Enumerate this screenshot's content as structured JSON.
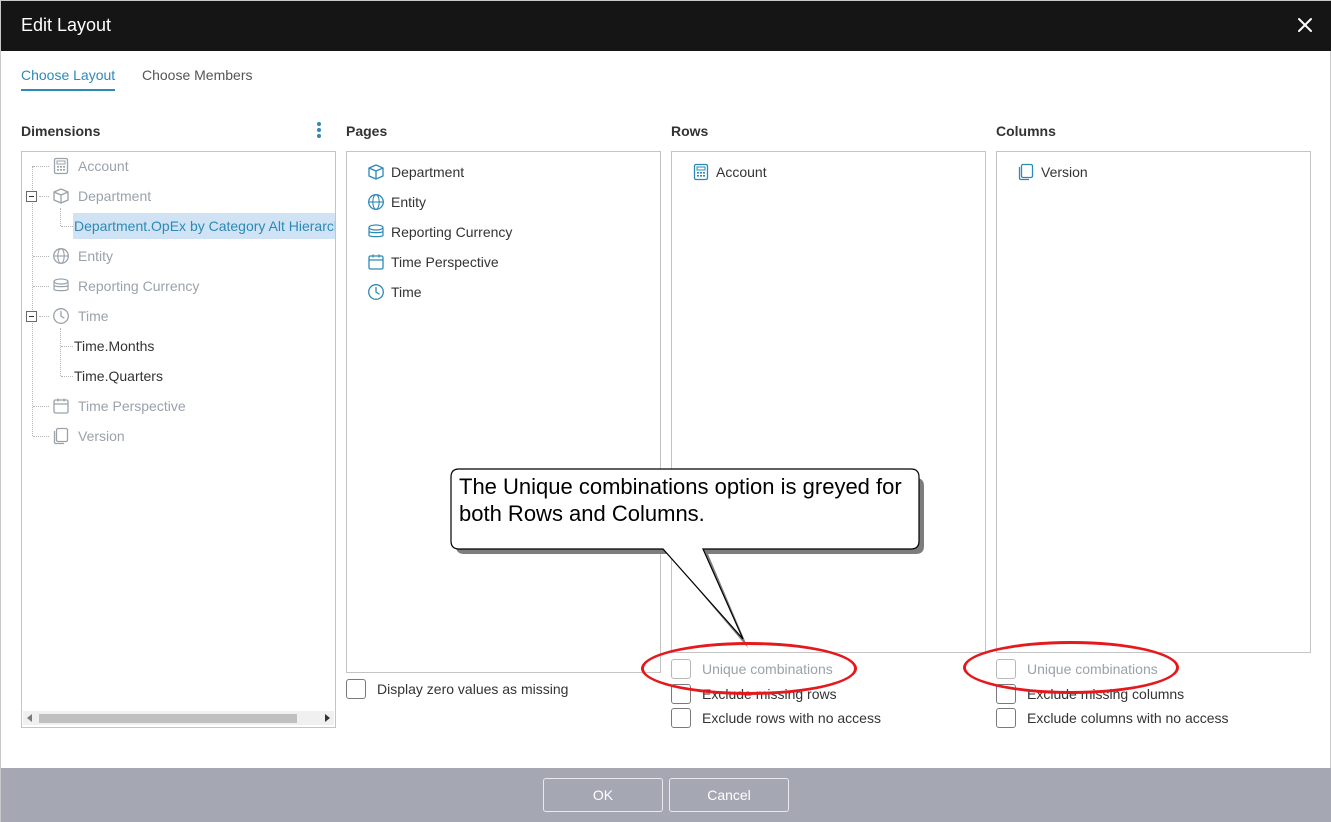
{
  "window": {
    "title": "Edit Layout",
    "close_icon": "close-icon"
  },
  "tabs": [
    {
      "label": "Choose Layout",
      "active": true
    },
    {
      "label": "Choose Members",
      "active": false
    }
  ],
  "dimensions": {
    "title": "Dimensions",
    "items": {
      "account": {
        "label": "Account",
        "icon": "calculator-icon"
      },
      "department": {
        "label": "Department",
        "icon": "cube-icon"
      },
      "department_child": {
        "label": "Department.OpEx by Category Alt Hierarchy"
      },
      "entity": {
        "label": "Entity",
        "icon": "globe-icon"
      },
      "reporting_currency": {
        "label": "Reporting Currency",
        "icon": "coins-icon"
      },
      "time": {
        "label": "Time",
        "icon": "clock-icon"
      },
      "time_months": {
        "label": "Time.Months"
      },
      "time_quarters": {
        "label": "Time.Quarters"
      },
      "time_perspective": {
        "label": "Time Perspective",
        "icon": "calendar-icon"
      },
      "version": {
        "label": "Version",
        "icon": "pages-icon"
      }
    }
  },
  "pages": {
    "title": "Pages",
    "items": [
      {
        "label": "Department",
        "icon": "cube-icon"
      },
      {
        "label": "Entity",
        "icon": "globe-icon"
      },
      {
        "label": "Reporting Currency",
        "icon": "coins-icon"
      },
      {
        "label": "Time Perspective",
        "icon": "calendar-icon"
      },
      {
        "label": "Time",
        "icon": "clock-icon"
      }
    ],
    "display_zero": "Display zero values as missing"
  },
  "rows": {
    "title": "Rows",
    "items": [
      {
        "label": "Account",
        "icon": "calculator-icon"
      }
    ],
    "options": {
      "unique": "Unique combinations",
      "exclude_missing": "Exclude missing rows",
      "exclude_no_access": "Exclude rows with no access"
    }
  },
  "columns": {
    "title": "Columns",
    "items": [
      {
        "label": "Version",
        "icon": "pages-icon"
      }
    ],
    "options": {
      "unique": "Unique combinations",
      "exclude_missing": "Exclude missing columns",
      "exclude_no_access": "Exclude columns with no access"
    }
  },
  "callout": {
    "text": "The Unique combinations option is greyed for both Rows and Columns."
  },
  "footer": {
    "ok": "OK",
    "cancel": "Cancel"
  },
  "colors": {
    "accent": "#2d8ab5",
    "titlebar": "#151515",
    "footer": "#a5a8b3",
    "annotation": "#e5181b",
    "disabled_text": "#9aa2aa"
  }
}
